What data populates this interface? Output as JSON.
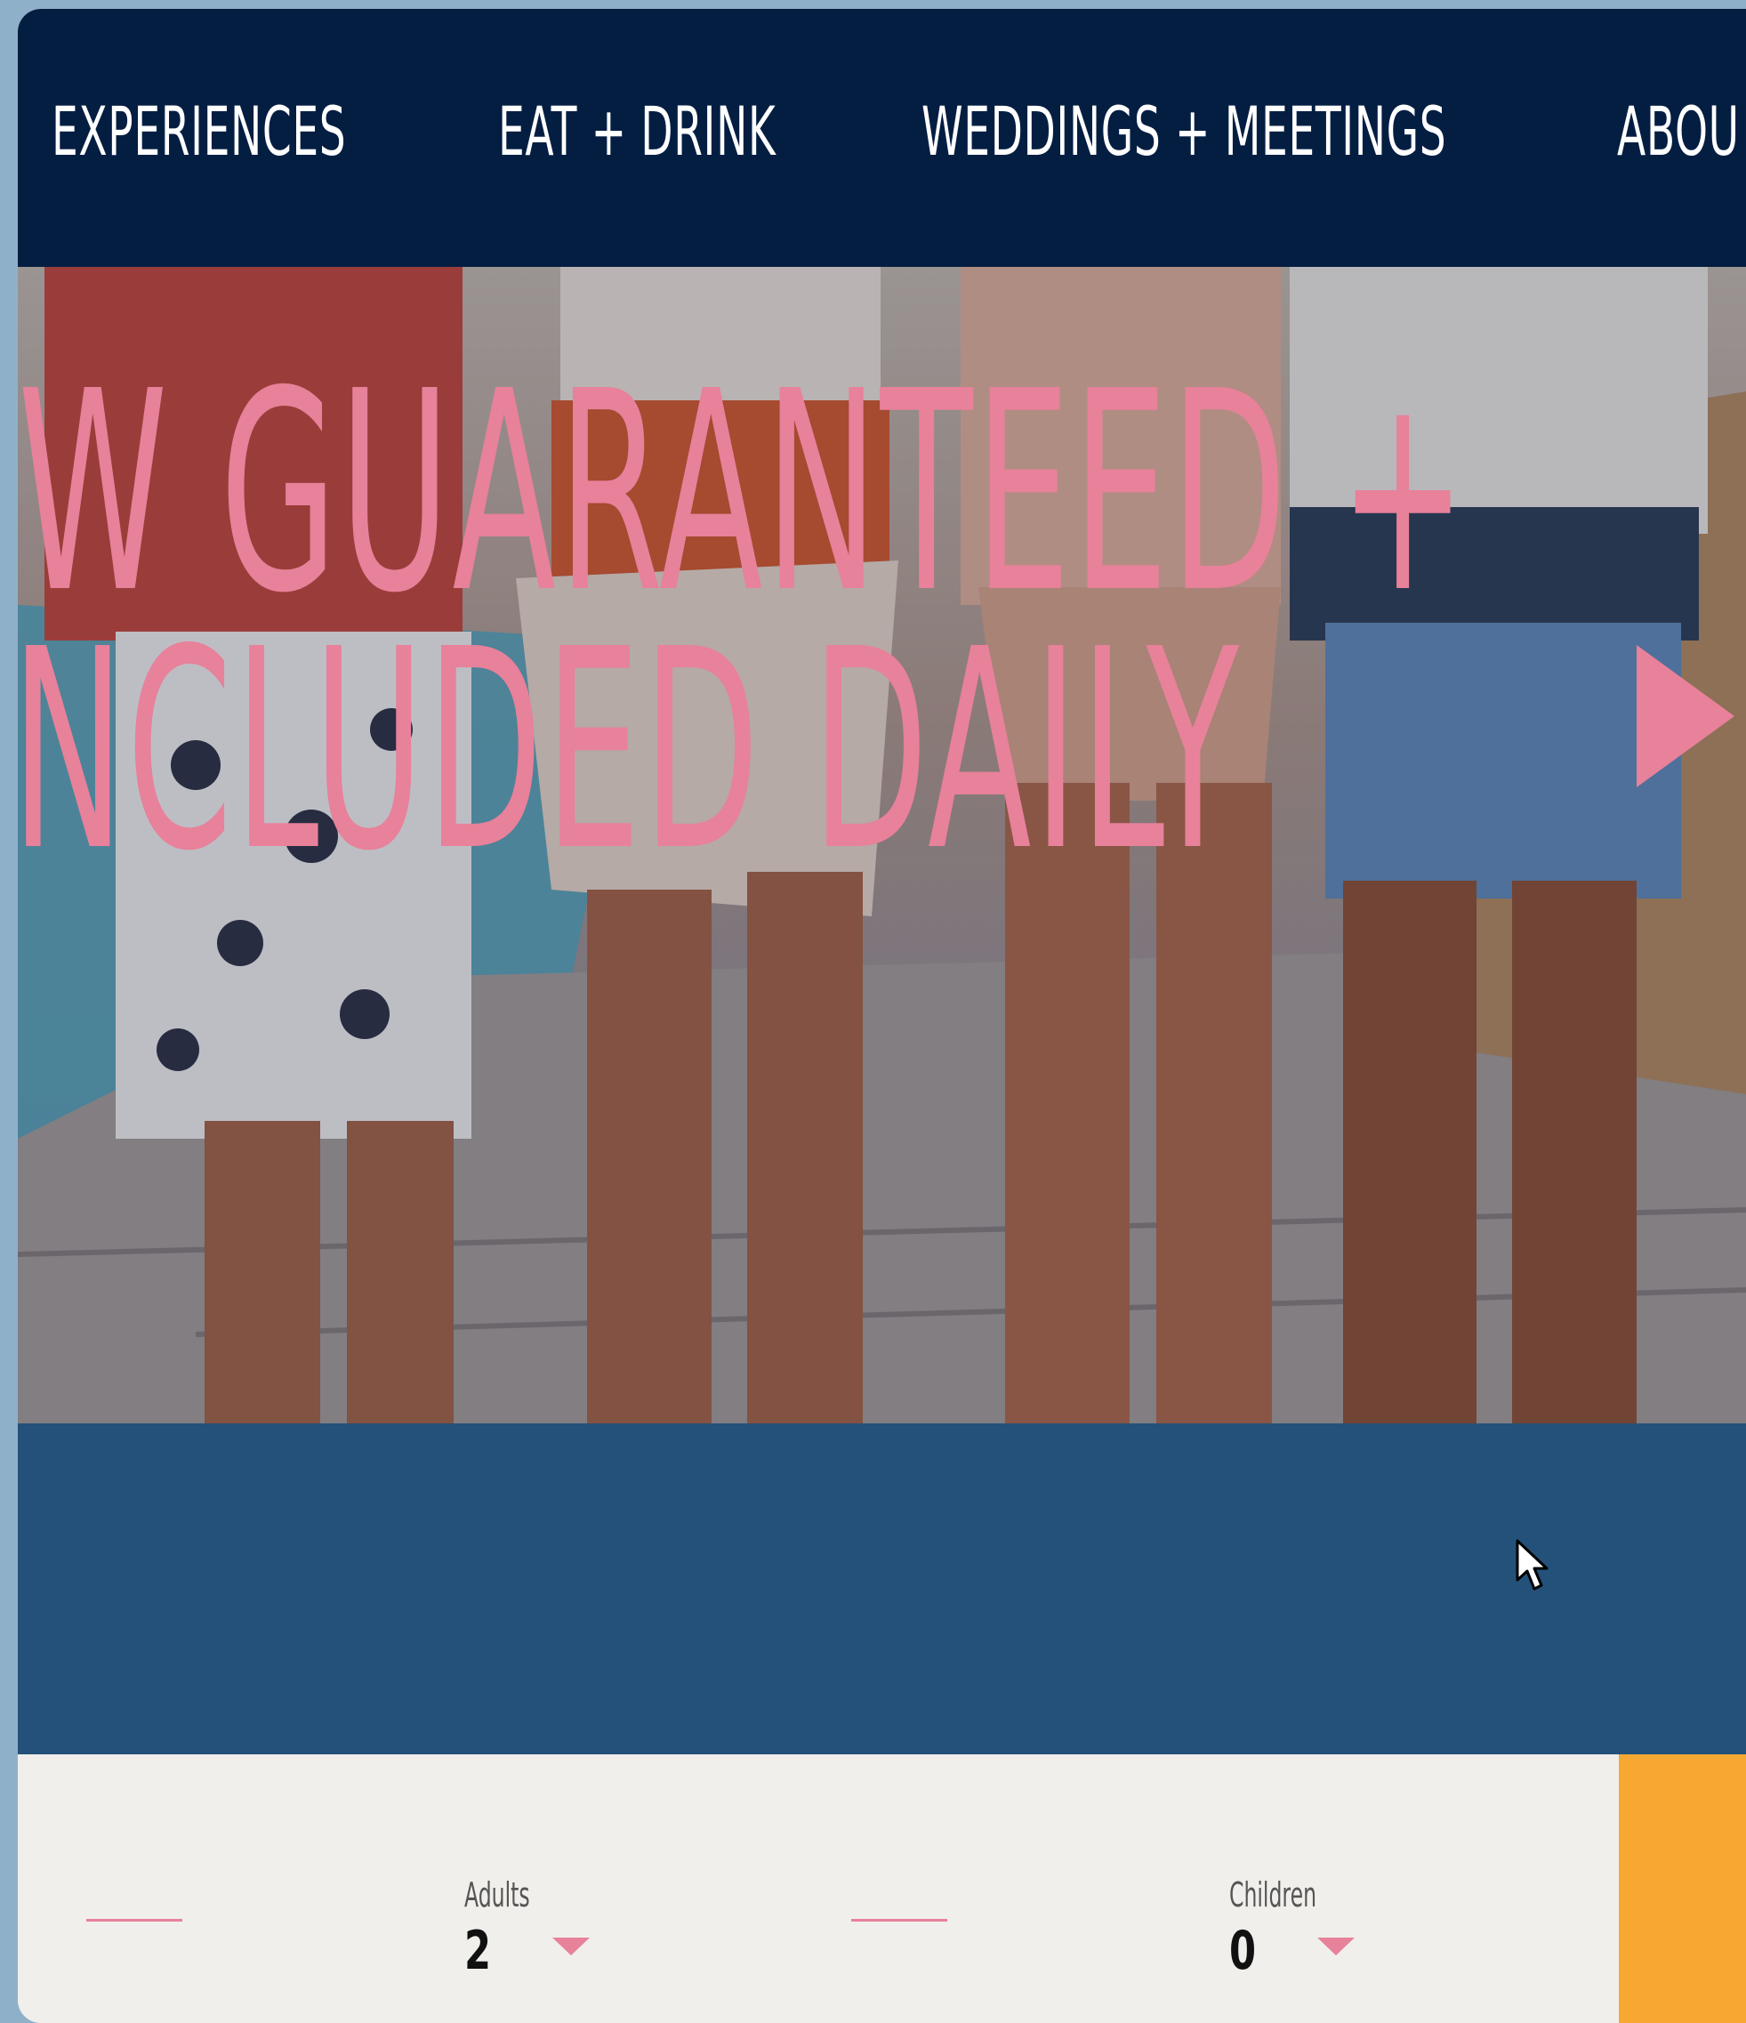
{
  "nav": {
    "items": [
      "EXPERIENCES",
      "EAT + DRINK",
      "WEDDINGS + MEETINGS",
      "ABOU"
    ]
  },
  "hero": {
    "line1": "EW GUARANTEED +",
    "line2": "INCLUDED DAILY",
    "arrow_icon": "play-arrow-icon",
    "text_color": "#e8819a"
  },
  "booking": {
    "adults_label": "Adults",
    "adults_value": "2",
    "children_label": "Children",
    "children_value": "0",
    "caret_icon": "caret-down-icon"
  },
  "colors": {
    "nav_bg": "#041e42",
    "band_bg": "#245179",
    "cta_bg": "#f7a833",
    "accent": "#e8819a"
  },
  "cursor_icon": "mouse-pointer-icon"
}
